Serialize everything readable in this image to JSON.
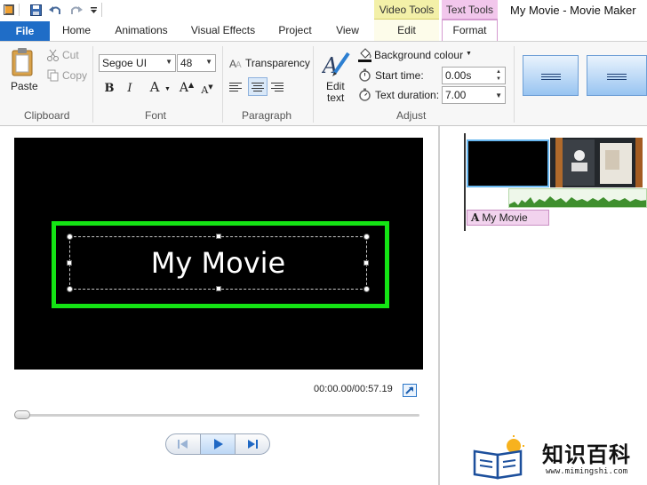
{
  "window": {
    "title": "My Movie - Movie Maker"
  },
  "contextual_tabs": {
    "video_tools": "Video Tools",
    "text_tools": "Text Tools"
  },
  "tabs": [
    {
      "label": "File"
    },
    {
      "label": "Home"
    },
    {
      "label": "Animations"
    },
    {
      "label": "Visual Effects"
    },
    {
      "label": "Project"
    },
    {
      "label": "View"
    },
    {
      "label": "Edit"
    },
    {
      "label": "Format"
    }
  ],
  "ribbon": {
    "clipboard": {
      "paste": "Paste",
      "cut": "Cut",
      "copy": "Copy",
      "group": "Clipboard"
    },
    "font": {
      "family": "Segoe UI",
      "size": "48",
      "group": "Font",
      "bold": "B",
      "italic": "I",
      "color": "A",
      "grow": "A",
      "shrink": "A"
    },
    "paragraph": {
      "transparency": "Transparency",
      "group": "Paragraph"
    },
    "adjust": {
      "edit_text_line1": "Edit",
      "edit_text_line2": "text",
      "background_colour": "Background colour",
      "start_time_label": "Start time:",
      "start_time_value": "0.00s",
      "text_duration_label": "Text duration:",
      "text_duration_value": "7.00",
      "group": "Adjust"
    }
  },
  "preview": {
    "caption": "My Movie",
    "timecode": "00:00.00/00:57.19",
    "progress_fraction": 0
  },
  "timeline": {
    "caption_clip": "My Movie"
  },
  "watermark": {
    "name": "知识百科",
    "url": "www.mimingshi.com"
  },
  "colors": {
    "file_tab": "#1f6dc7",
    "video_tools": "#f3f0a8",
    "text_tools": "#f2c7ec",
    "caption_frame": "#14e414",
    "selected_clip": "#69b7ef"
  }
}
